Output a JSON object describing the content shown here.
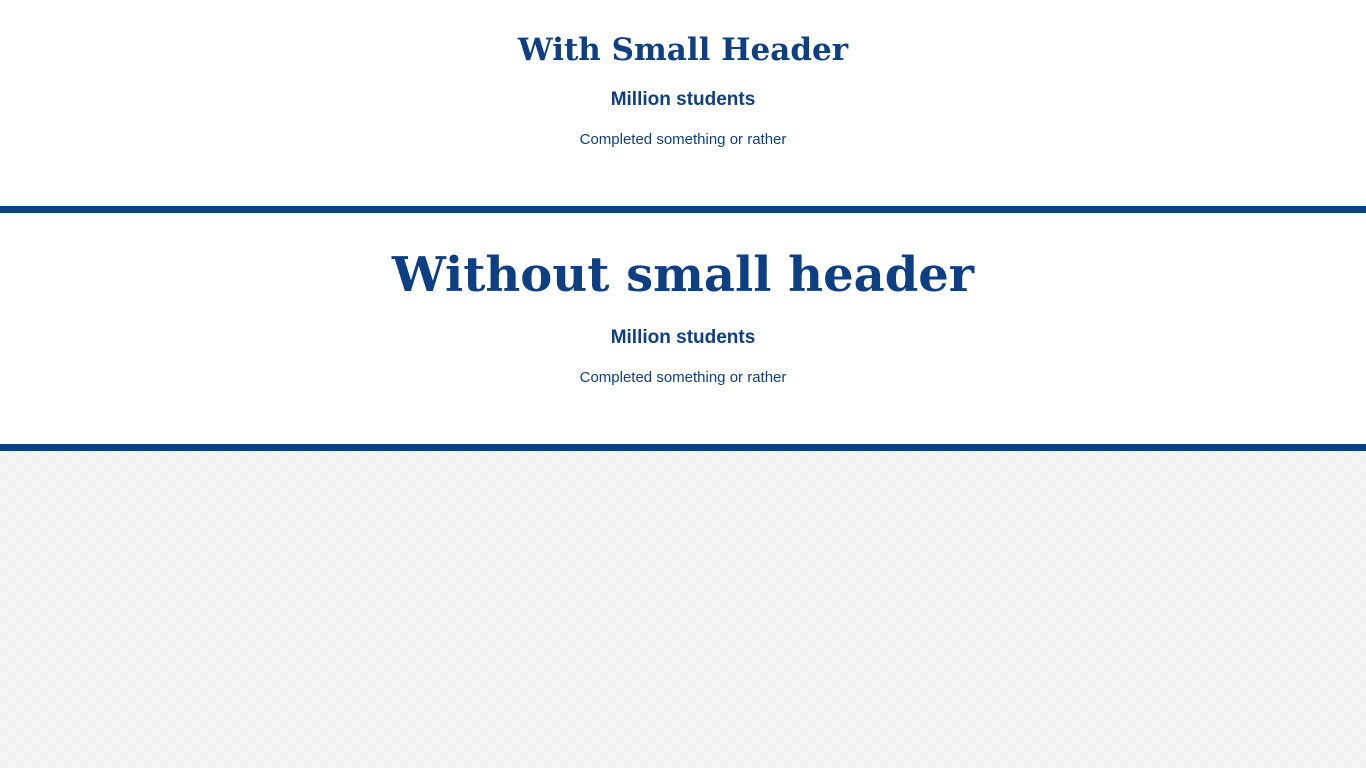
{
  "sections": [
    {
      "title": "With Small Header",
      "stat": "Million students",
      "description": "Completed something or rather"
    },
    {
      "title": "Without small header",
      "stat": "Million students",
      "description": "Completed something or rather"
    }
  ],
  "colors": {
    "primary": "#0d3f82",
    "background": "#ffffff",
    "page_background": "#f6f6f6"
  }
}
